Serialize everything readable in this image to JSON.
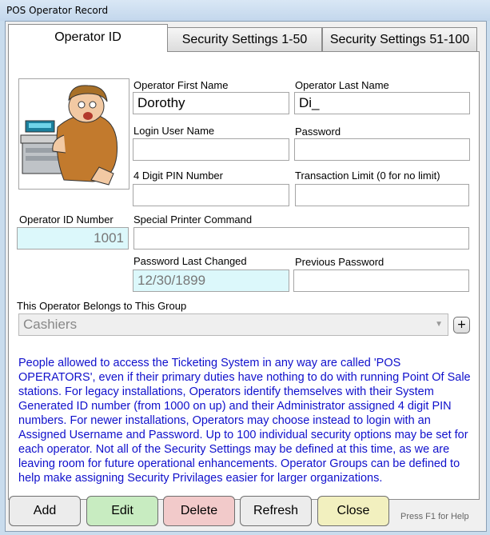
{
  "window": {
    "title": "POS Operator Record"
  },
  "tabs": [
    {
      "label": "Operator ID",
      "active": true
    },
    {
      "label": "Security Settings 1-50",
      "active": false
    },
    {
      "label": "Security Settings 51-100",
      "active": false
    }
  ],
  "fields": {
    "first_name": {
      "label": "Operator First Name",
      "value": "Dorothy"
    },
    "last_name": {
      "label": "Operator Last Name",
      "value": "Di_"
    },
    "login_user": {
      "label": "Login User Name",
      "value": ""
    },
    "password": {
      "label": "Password",
      "value": ""
    },
    "pin": {
      "label": "4 Digit PIN Number",
      "value": ""
    },
    "transaction_limit": {
      "label": "Transaction Limit (0 for no limit)",
      "value": ""
    },
    "operator_id": {
      "label": "Operator ID Number",
      "value": "1001"
    },
    "printer_command": {
      "label": "Special Printer Command",
      "value": ""
    },
    "password_changed": {
      "label": "Password Last Changed",
      "value": "12/30/1899"
    },
    "previous_password": {
      "label": "Previous Password",
      "value": ""
    }
  },
  "group": {
    "label": "This Operator Belongs to This Group",
    "value": "Cashiers",
    "add_label": "+"
  },
  "info_text": "People allowed to access the Ticketing System in any way are called 'POS OPERATORS', even if their primary duties have nothing to do with running Point Of Sale stations.  For legacy installations, Operators identify themselves with their System Generated ID number (from 1000 on up) and their Administrator assigned 4 digit PIN numbers.  For newer installations, Operators may choose instead to login with an Assigned Username and Password.  Up to 100 individual security options may be set for each operator.  Not all of the Security Settings may be defined at this time, as we are leaving room for future operational enhancements. Operator Groups can be defined to help make assigning Security Privilages easier for larger organizations.",
  "buttons": {
    "add": {
      "label": "Add",
      "color": "#ececec"
    },
    "edit": {
      "label": "Edit",
      "color": "#c8ecc1"
    },
    "delete": {
      "label": "Delete",
      "color": "#f2caca"
    },
    "refresh": {
      "label": "Refresh",
      "color": "#ececec"
    },
    "close": {
      "label": "Close",
      "color": "#f2f0bf"
    }
  },
  "help_text": "Press F1 for Help",
  "icons": {
    "operator_photo": "cashier-clipart"
  },
  "colors": {
    "info_text": "#1010cc",
    "readonly_field": "#dcf8fb"
  }
}
